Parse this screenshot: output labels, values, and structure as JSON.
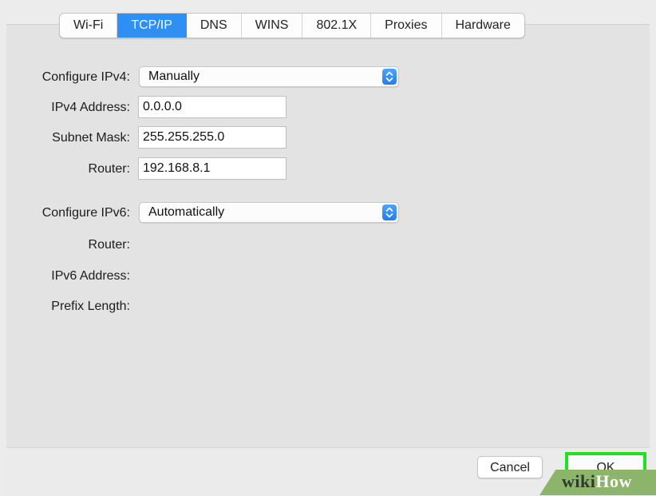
{
  "tabs": [
    {
      "label": "Wi-Fi",
      "active": false
    },
    {
      "label": "TCP/IP",
      "active": true
    },
    {
      "label": "DNS",
      "active": false
    },
    {
      "label": "WINS",
      "active": false
    },
    {
      "label": "802.1X",
      "active": false
    },
    {
      "label": "Proxies",
      "active": false
    },
    {
      "label": "Hardware",
      "active": false
    }
  ],
  "ipv4": {
    "configure_label": "Configure IPv4:",
    "configure_value": "Manually",
    "address_label": "IPv4 Address:",
    "address_value": "0.0.0.0",
    "subnet_label": "Subnet Mask:",
    "subnet_value": "255.255.255.0",
    "router_label": "Router:",
    "router_value": "192.168.8.1"
  },
  "ipv6": {
    "configure_label": "Configure IPv6:",
    "configure_value": "Automatically",
    "router_label": "Router:",
    "address_label": "IPv6 Address:",
    "prefix_label": "Prefix Length:"
  },
  "buttons": {
    "cancel": "Cancel",
    "ok": "OK"
  },
  "watermark": {
    "part1": "wiki",
    "part2": "How"
  },
  "colors": {
    "active_tab": "#2e8ff5",
    "highlight": "#22e01e",
    "watermark_bg": "#8cb46a"
  },
  "icons": {
    "select_arrows": "chevron-up-down-icon"
  }
}
